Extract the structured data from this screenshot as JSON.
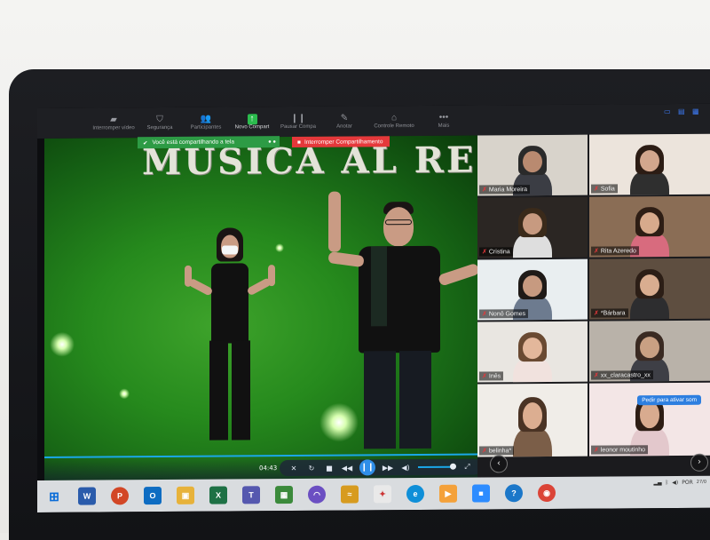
{
  "toolbar": {
    "items": [
      {
        "label": "Interromper vídeo",
        "icon": "video-camera-icon"
      },
      {
        "label": "Segurança",
        "icon": "shield-icon"
      },
      {
        "label": "Participantes",
        "icon": "participants-icon"
      },
      {
        "label": "Novo Compart",
        "icon": "share-screen-icon"
      },
      {
        "label": "Pausar Compa",
        "icon": "pause-icon"
      },
      {
        "label": "Anotar",
        "icon": "pen-icon"
      },
      {
        "label": "Controle Remoto",
        "icon": "mouse-icon"
      },
      {
        "label": "Mais",
        "icon": "more-icon"
      }
    ]
  },
  "sharing_banner": "Você está compartilhando a tela",
  "stop_share_label": "Interromper Compartilhamento",
  "video": {
    "title": "MUSICA AL RE",
    "time": "04:43",
    "progress": 1.0,
    "volume": 0.9
  },
  "gallery": {
    "participants": [
      {
        "name": "Maria Moreira",
        "muted": true
      },
      {
        "name": "Sofia",
        "muted": true
      },
      {
        "name": "Cristina",
        "muted": true
      },
      {
        "name": "Rita Azeredo",
        "muted": true
      },
      {
        "name": "Nonô Gomes",
        "muted": true
      },
      {
        "name": "*Bárbara",
        "muted": true
      },
      {
        "name": "Inês",
        "muted": true
      },
      {
        "name": "xx_claracastro_xx",
        "muted": true
      },
      {
        "name": "belinha*",
        "muted": true
      },
      {
        "name": "leonor moutinho",
        "muted": true
      }
    ],
    "request_label": "Pedir para ativar som"
  },
  "taskbar": {
    "language": "POR",
    "date": "27/0"
  },
  "colors": {
    "share_green": "#2d9b45",
    "stop_red": "#e5383b",
    "zoom_blue": "#2d7fe0"
  }
}
